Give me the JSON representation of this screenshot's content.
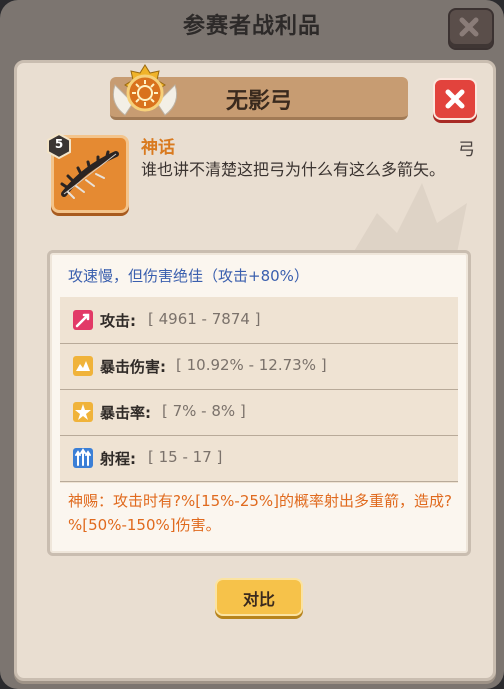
{
  "window": {
    "title": "参赛者战利品"
  },
  "item": {
    "name": "无影弓",
    "level": "5",
    "rarity": "神话",
    "type": "弓",
    "description": "谁也讲不清楚这把弓为什么有这么多箭矢。"
  },
  "stats": {
    "summary": "攻速慢，但伤害绝佳（攻击+80%）",
    "rows": [
      {
        "icon": "attack-icon",
        "label": "攻击:",
        "value": "[ 4961 - 7874 ]"
      },
      {
        "icon": "crit-damage-icon",
        "label": "暴击伤害:",
        "value": "[ 10.92% - 12.73% ]"
      },
      {
        "icon": "crit-rate-icon",
        "label": "暴击率:",
        "value": "[ 7% - 8% ]"
      },
      {
        "icon": "range-icon",
        "label": "射程:",
        "value": "[ 15 - 17 ]"
      }
    ],
    "blessing": "神赐：攻击时有?%[15%-25%]的概率射出多重箭，造成?%[50%-150%]伤害。"
  },
  "buttons": {
    "compare": "对比"
  },
  "colors": {
    "rarity": "#d97a1f",
    "summary": "#3a5fae",
    "blessing": "#e06a1e",
    "close": "#e2433d",
    "compare": "#f6c24a"
  }
}
